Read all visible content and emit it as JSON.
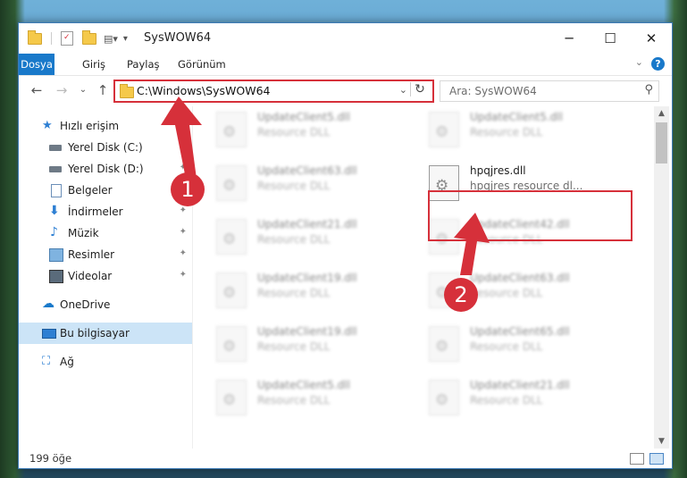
{
  "window": {
    "title": "SysWOW64",
    "minimize": "─",
    "maximize": "☐",
    "close": "✕"
  },
  "ribbon": {
    "tabs": [
      "Dosya",
      "Giriş",
      "Paylaş",
      "Görünüm"
    ],
    "help": "?",
    "collapse": "⌄"
  },
  "nav": {
    "back": "←",
    "forward": "→",
    "recent": "⌄",
    "up": "↑",
    "address_path": "C:\\Windows\\SysWOW64",
    "address_dropdown": "⌄",
    "refresh": "↻",
    "search_placeholder": "Ara: SysWOW64",
    "search_icon": "⚲"
  },
  "sidebar": {
    "items": [
      {
        "label": "Hızlı erişim",
        "icon": "star-icon"
      },
      {
        "label": "Yerel Disk (C:)",
        "icon": "drive-icon",
        "pinned": true
      },
      {
        "label": "Yerel Disk (D:)",
        "icon": "drive-icon",
        "pinned": true
      },
      {
        "label": "Belgeler",
        "icon": "documents-icon",
        "pinned": true
      },
      {
        "label": "İndirmeler",
        "icon": "downloads-icon",
        "pinned": true
      },
      {
        "label": "Müzik",
        "icon": "music-icon",
        "pinned": true
      },
      {
        "label": "Resimler",
        "icon": "pictures-icon",
        "pinned": true
      },
      {
        "label": "Videolar",
        "icon": "videos-icon",
        "pinned": true
      },
      {
        "label": "OneDrive",
        "icon": "cloud-icon"
      },
      {
        "label": "Bu bilgisayar",
        "icon": "computer-icon",
        "selected": true
      },
      {
        "label": "Ağ",
        "icon": "network-icon"
      }
    ],
    "pin_glyph": "📌"
  },
  "files": {
    "col1": [
      {
        "name": "UpdateClient5.dll",
        "type": "Resource DLL"
      },
      {
        "name": "UpdateClient63.dll",
        "type": "Resource DLL"
      },
      {
        "name": "UpdateClient21.dll",
        "type": "Resource DLL"
      },
      {
        "name": "UpdateClient19.dll",
        "type": "Resource DLL"
      },
      {
        "name": "UpdateClient19.dll",
        "type": "Resource DLL"
      },
      {
        "name": "UpdateClient5.dll",
        "type": "Resource DLL"
      }
    ],
    "col2": [
      {
        "name": "UpdateClient5.dll",
        "type": "Resource DLL"
      },
      {
        "name": "hpqjres.dll",
        "type": "hpqjres resource dl...",
        "highlighted": true
      },
      {
        "name": "UpdateClient42.dll",
        "type": "Resource DLL"
      },
      {
        "name": "UpdateClient63.dll",
        "type": "Resource DLL"
      },
      {
        "name": "UpdateClient65.dll",
        "type": "Resource DLL"
      },
      {
        "name": "UpdateClient21.dll",
        "type": "Resource DLL"
      }
    ]
  },
  "status": {
    "item_count": "199 öğe"
  },
  "annotations": {
    "badge1": "1",
    "badge2": "2",
    "color": "#d6303a"
  }
}
